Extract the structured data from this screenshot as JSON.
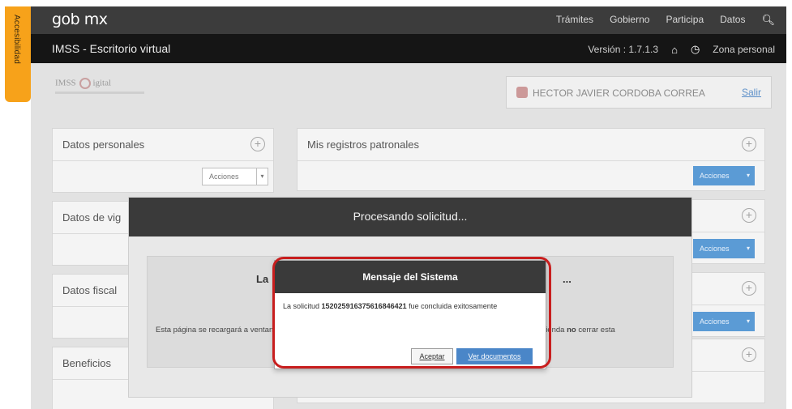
{
  "accessibility_tab": "Accesibilidad",
  "topbar": {
    "brand": "gob mx",
    "nav": [
      "Trámites",
      "Gobierno",
      "Participa",
      "Datos"
    ],
    "search_icon": "search-icon"
  },
  "subbar": {
    "title": "IMSS - Escritorio virtual",
    "version": "Versión : 1.7.1.3",
    "home_icon": "home-icon",
    "clock_icon": "clock-icon",
    "zone": "Zona personal"
  },
  "logo": {
    "text": "IMSS",
    "suffix": "igital"
  },
  "user": {
    "name": "HECTOR JAVIER CORDOBA CORREA",
    "logout": "Salir"
  },
  "panels": {
    "datos_personales": "Datos personales",
    "datos_vigencia": "Datos de vig",
    "datos_fiscales": "Datos fiscal",
    "beneficios": "Beneficios",
    "mis_registros": "Mis registros patronales",
    "actions_label": "Acciones"
  },
  "processing": {
    "title": "Procesando solicitud...",
    "lead": "La",
    "ellipsis": "...",
    "note_left": "Esta página se recargará a ventana.",
    "note_right_prefix": "omienda ",
    "note_right_bold": "no",
    "note_right_suffix": " cerrar esta"
  },
  "dialog": {
    "title": "Mensaje del Sistema",
    "msg_prefix": "La solicitud ",
    "request_number": "152025916375616846421",
    "msg_suffix": " fue concluida exitosamente",
    "accept": "Aceptar",
    "view_docs": "Ver documentos"
  },
  "colors": {
    "accent_orange": "#f7a21a",
    "primary_blue": "#5b9bd5",
    "highlight_red": "#c81e1e",
    "dark_bar": "#151515"
  }
}
